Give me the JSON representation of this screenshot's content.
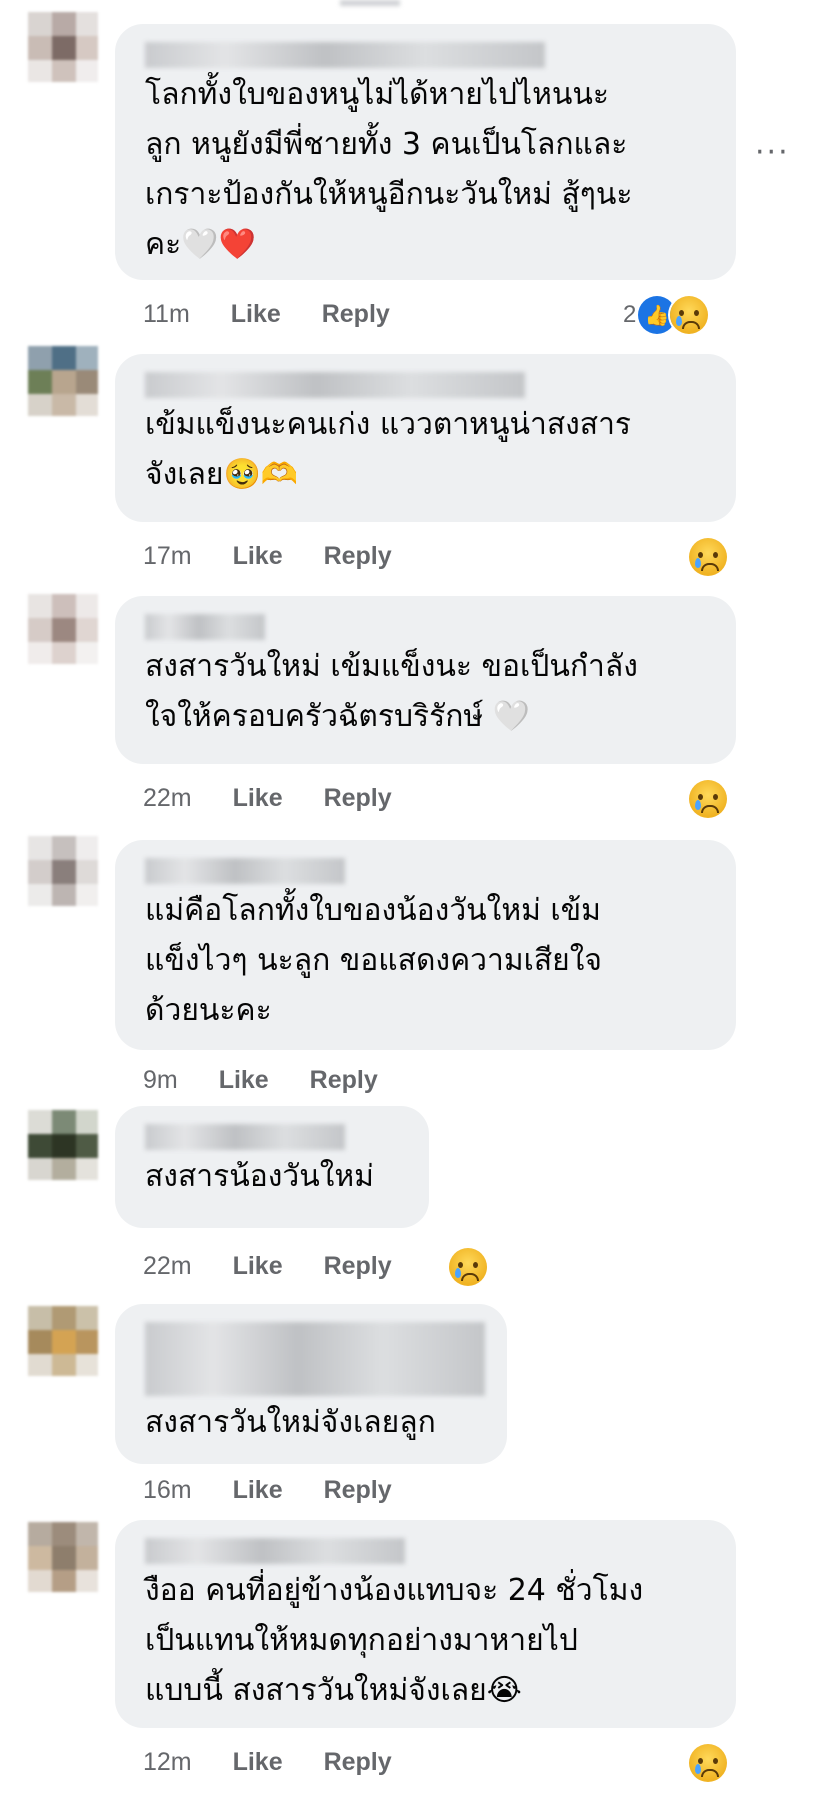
{
  "more_icon": "ellipsis-icon",
  "comments": [
    {
      "text": "โลกทั้งใบของหนูไม่ได้หายไปไหนนะ\nลูก หนูยังมีพี่ชายทั้ง 3 คนเป็นโลกและ\nเกราะป้องกันให้หนูอีกนะวันใหม่ สู้ๆนะ\nคะ🤍❤️",
      "time": "11m",
      "like": "Like",
      "reply": "Reply",
      "reaction_count": "2",
      "reactions": [
        "like",
        "sad"
      ]
    },
    {
      "text": "เข้มแข็งนะคนเก่ง แววตาหนูน่าสงสาร\nจังเลย🥹🫶",
      "time": "17m",
      "like": "Like",
      "reply": "Reply",
      "reactions": [
        "sad"
      ]
    },
    {
      "text": "สงสารวันใหม่ เข้มแข็งนะ ขอเป็นกำลัง\nใจให้ครอบครัวฉัตรบริรักษ์ 🤍",
      "time": "22m",
      "like": "Like",
      "reply": "Reply",
      "reactions": [
        "sad"
      ]
    },
    {
      "text": "แม่คือโลกทั้งใบของน้องวันใหม่ เข้ม\nแข็งไวๆ นะลูก ขอแสดงความเสียใจ\nด้วยนะคะ",
      "time": "9m",
      "like": "Like",
      "reply": "Reply",
      "reactions": []
    },
    {
      "text": "สงสารน้องวันใหม่",
      "time": "22m",
      "like": "Like",
      "reply": "Reply",
      "reactions": [
        "sad"
      ]
    },
    {
      "text": "สงสารวันใหม่จังเลยลูก",
      "time": "16m",
      "like": "Like",
      "reply": "Reply",
      "reactions": []
    },
    {
      "text": "งืออ คนที่อยู่ข้างน้องแทบจะ 24 ชั่วโมง\nเป็นแทนให้หมดทุกอย่างมาหายไป\nแบบนี้ สงสารวันใหม่จังเลย😭",
      "time": "12m",
      "like": "Like",
      "reply": "Reply",
      "reactions": [
        "sad"
      ]
    }
  ]
}
